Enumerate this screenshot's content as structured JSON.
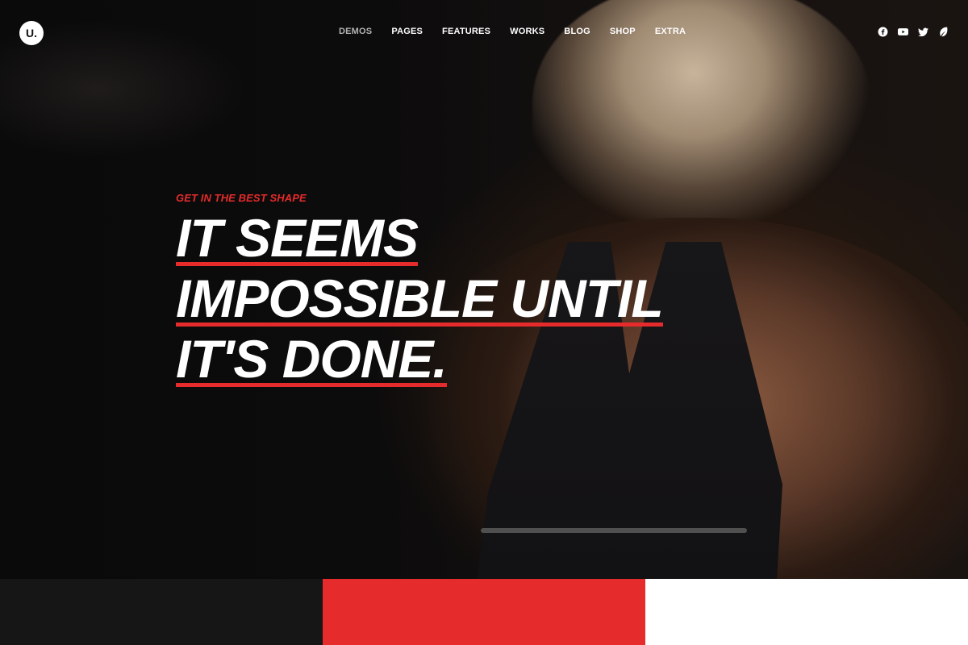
{
  "header": {
    "logo_text": "U.",
    "nav": [
      "DEMOS",
      "PAGES",
      "FEATURES",
      "WORKS",
      "BLOG",
      "SHOP",
      "EXTRA"
    ],
    "active_nav": "DEMOS",
    "social_icons": [
      "facebook-icon",
      "youtube-icon",
      "twitter-icon",
      "leaf-icon"
    ]
  },
  "hero": {
    "kicker": "GET IN THE BEST SHAPE",
    "headline_lines": [
      "IT SEEMS",
      "IMPOSSIBLE UNTIL",
      "IT'S DONE."
    ]
  },
  "colors": {
    "accent": "#e52b2b",
    "strip": [
      "#161616",
      "#e52b2b",
      "#ffffff"
    ]
  }
}
